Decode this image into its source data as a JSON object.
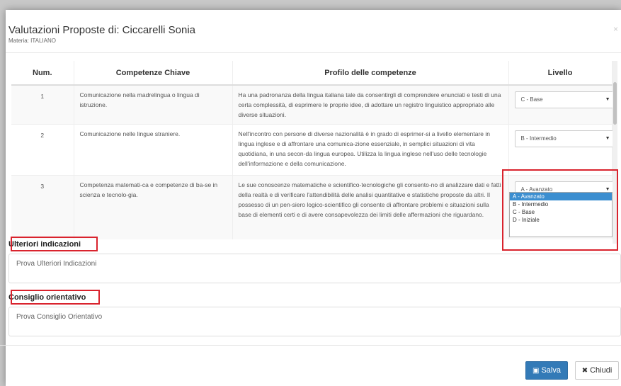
{
  "modal": {
    "title": "Valutazioni Proposte di: Ciccarelli Sonia",
    "subtitle": "Materia: ITALIANO",
    "close_glyph": "×"
  },
  "table": {
    "headers": [
      "Num.",
      "Competenze Chiave",
      "Profilo delle competenze",
      "Livello"
    ],
    "rows": [
      {
        "num": "1",
        "competenza": "Comunicazione nella madrelingua o lingua di istruzione.",
        "profilo": "Ha una padronanza della lingua italiana tale da consentirgli di comprendere enunciati e testi di una certa complessità, di esprimere le proprie idee, di adottare un registro linguistico appropriato alle diverse situazioni.",
        "livello": "C - Base"
      },
      {
        "num": "2",
        "competenza": "Comunicazione nelle lingue straniere.",
        "profilo": "Nell'incontro con persone di diverse nazionalità è in grado di esprimer-si a livello elementare in lingua inglese e di affrontare una comunica-zione essenziale, in semplici situazioni di vita quotidiana, in una secon-da lingua europea. Utilizza la lingua inglese nell'uso delle tecnologie dell'informazione e della comunicazione.",
        "livello": "B - Intermedio"
      },
      {
        "num": "3",
        "competenza": "Competenza matemati-ca e competenze di ba-se in scienza e tecnolo-gia.",
        "profilo": "Le sue conoscenze matematiche e scientifico-tecnologiche gli consento-no di analizzare dati e fatti della realtà e di verificare l'attendibilità delle analisi quantitative e statistiche proposte da altri. Il possesso di un pen-siero logico-scientifico gli consente di affrontare problemi e situazioni sulla base di elementi certi e di avere consapevolezza dei limiti delle affermazioni che riguardano.",
        "livello": "A - Avanzato"
      }
    ]
  },
  "dropdown": {
    "options": [
      "A - Avanzato",
      "B - Intermedio",
      "C - Base",
      "D - Iniziale"
    ],
    "selected_index": 0
  },
  "ulteriori": {
    "label": "Ulteriori indicazioni",
    "value": "Prova Ulteriori Indicazioni"
  },
  "consiglio": {
    "label": "Consiglio orientativo",
    "value": "Prova Consiglio Orientativo"
  },
  "buttons": {
    "save": "Salva",
    "close": "Chiudi"
  },
  "colors": {
    "highlight_red": "#d9232d",
    "primary_blue": "#337ab7",
    "option_selected": "#3b8ed0"
  }
}
